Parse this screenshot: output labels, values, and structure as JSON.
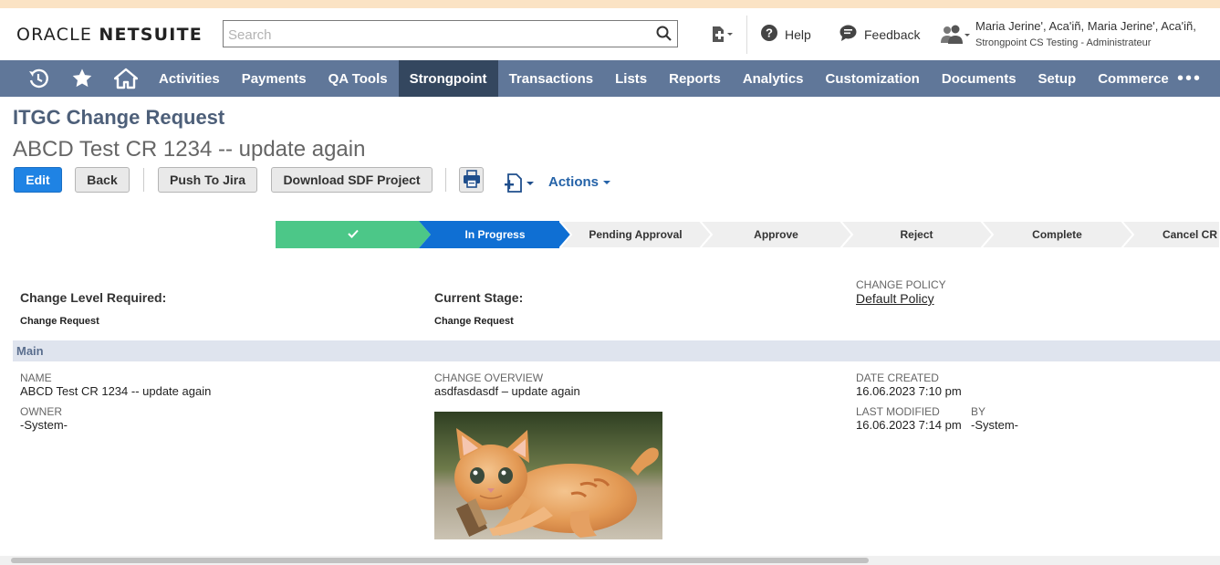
{
  "header": {
    "logo_oracle": "ORACLE",
    "logo_netsuite": "NETSUITE",
    "search_placeholder": "Search",
    "help": "Help",
    "feedback": "Feedback",
    "user_name": "Maria Jerine', Aca'iñ, Maria Jerine', Aca'iñ,",
    "user_role": "Strongpoint CS Testing - Administrateur"
  },
  "nav": {
    "items": [
      "Activities",
      "Payments",
      "QA Tools",
      "Strongpoint",
      "Transactions",
      "Lists",
      "Reports",
      "Analytics",
      "Customization",
      "Documents",
      "Setup",
      "Commerce"
    ],
    "active": "Strongpoint",
    "more": "•••"
  },
  "record": {
    "type": "ITGC Change Request",
    "title": "ABCD Test CR 1234 -- update again"
  },
  "buttons": {
    "edit": "Edit",
    "back": "Back",
    "push_to_jira": "Push To Jira",
    "download_sdf": "Download SDF Project",
    "actions": "Actions"
  },
  "workflow": {
    "stages": [
      {
        "label": "",
        "state": "done"
      },
      {
        "label": "In Progress",
        "state": "current"
      },
      {
        "label": "Pending Approval",
        "state": "pending"
      },
      {
        "label": "Approve",
        "state": "pending"
      },
      {
        "label": "Reject",
        "state": "pending"
      },
      {
        "label": "Complete",
        "state": "pending"
      },
      {
        "label": "Cancel CR",
        "state": "pending"
      }
    ]
  },
  "summary": {
    "change_level_label": "Change Level Required:",
    "change_level_value": "Change Request",
    "current_stage_label": "Current Stage:",
    "current_stage_value": "Change Request",
    "change_policy_label": "CHANGE POLICY",
    "change_policy_value": "Default Policy"
  },
  "main": {
    "section_title": "Main",
    "name_label": "NAME",
    "name_value": "ABCD Test CR 1234 -- update again",
    "owner_label": "OWNER",
    "owner_value": "-System-",
    "overview_label": "CHANGE OVERVIEW",
    "overview_value": "asdfasdasdf – update again",
    "date_created_label": "DATE CREATED",
    "date_created_value": "16.06.2023 7:10 pm",
    "last_modified_label": "LAST MODIFIED",
    "last_modified_value": "16.06.2023 7:14 pm",
    "by_label": "BY",
    "by_value": "-System-"
  },
  "colors": {
    "nav_bg": "#607799",
    "nav_active": "#34475f",
    "primary_button": "#1f83e4",
    "stage_done": "#4cc788",
    "stage_current": "#0f6fd3",
    "stage_pending": "#efefef"
  }
}
